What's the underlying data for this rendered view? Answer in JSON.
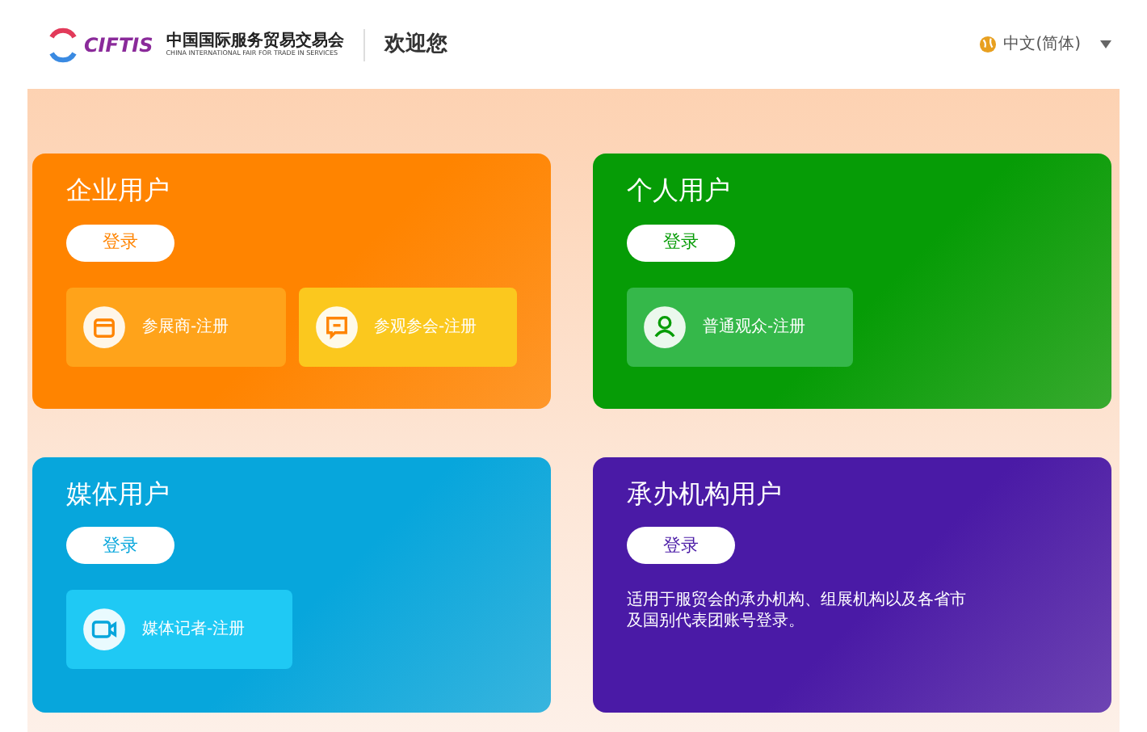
{
  "header": {
    "logo": {
      "mark": "CIFTIS",
      "name_cn": "中国国际服务贸易交易会",
      "name_en": "CHINA INTERNATIONAL FAIR FOR TRADE IN SERVICES"
    },
    "welcome": "欢迎您",
    "language": "中文(简体)"
  },
  "cards": [
    {
      "title": "企业用户",
      "color": "#ff8400",
      "login": "登录",
      "options": [
        {
          "kind": "shop",
          "label": "参展商-注册",
          "color": "#ffa31a"
        },
        {
          "kind": "chat",
          "label": "参观参会-注册",
          "color": "#fbc81e"
        }
      ]
    },
    {
      "title": "个人用户",
      "color": "#069c06",
      "login": "登录",
      "options": [
        {
          "kind": "person",
          "label": "普通观众-注册",
          "color": "#35b84a"
        }
      ]
    },
    {
      "title": "媒体用户",
      "color": "#07a6dc",
      "login": "登录",
      "options": [
        {
          "kind": "video",
          "label": "媒体记者-注册",
          "color": "#1fc9f4"
        }
      ]
    },
    {
      "title": "承办机构用户",
      "color": "#4a1aa6",
      "login": "登录",
      "description": "适用于服贸会的承办机构、组展机构以及各省市及国别代表团账号登录。"
    }
  ]
}
